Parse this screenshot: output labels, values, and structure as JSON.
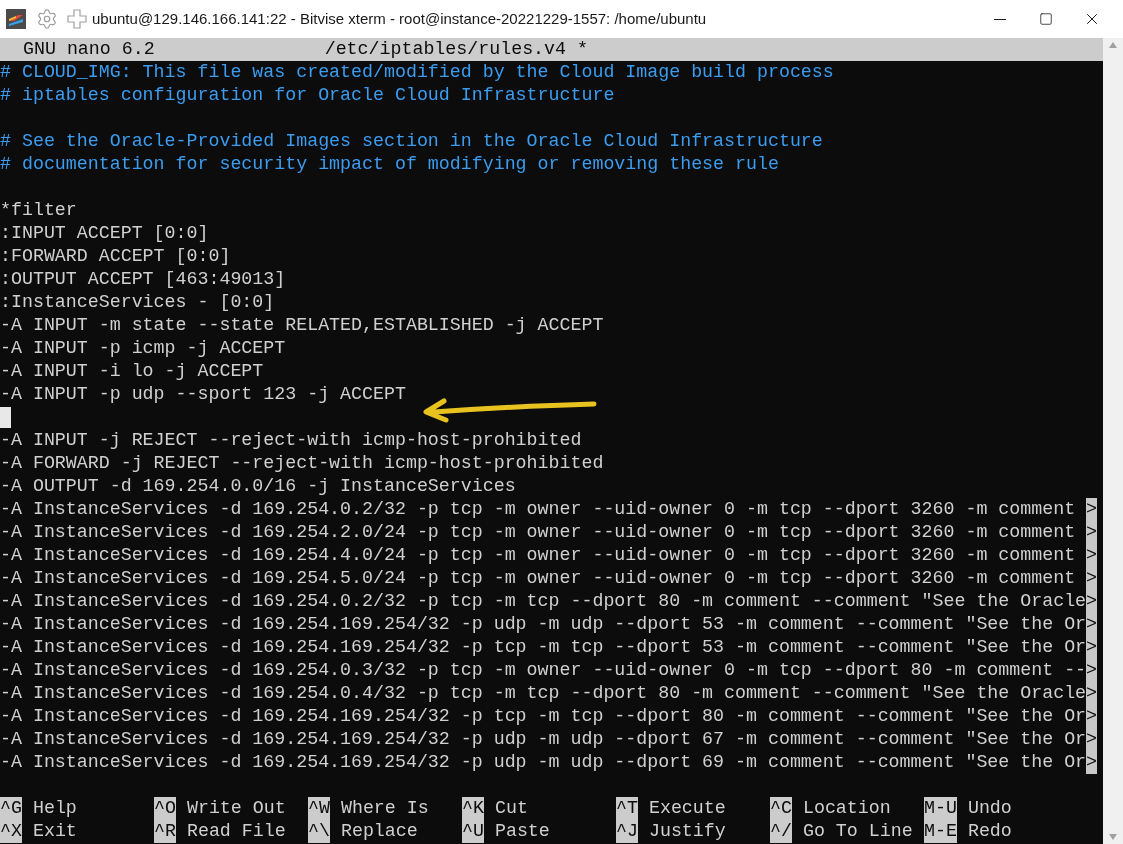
{
  "window": {
    "title": "ubuntu@129.146.166.141:22 - Bitvise xterm - root@instance-20221229-1557: /home/ubuntu"
  },
  "nano_header": {
    "version": "GNU nano 6.2",
    "filename": "/etc/iptables/rules.v4 *"
  },
  "lines": [
    {
      "kind": "comment",
      "text": "# CLOUD_IMG: This file was created/modified by the Cloud Image build process",
      "cursor": false
    },
    {
      "kind": "comment",
      "text": "# iptables configuration for Oracle Cloud Infrastructure",
      "cursor": false
    },
    {
      "kind": "blank",
      "cursor": false
    },
    {
      "kind": "comment",
      "text": "# See the Oracle-Provided Images section in the Oracle Cloud Infrastructure",
      "cursor": false
    },
    {
      "kind": "comment",
      "text": "# documentation for security impact of modifying or removing these rule",
      "cursor": false
    },
    {
      "kind": "blank",
      "cursor": false
    },
    {
      "kind": "code",
      "text": "*filter",
      "cursor": false
    },
    {
      "kind": "code",
      "text": ":INPUT ACCEPT [0:0]",
      "cursor": false
    },
    {
      "kind": "code",
      "text": ":FORWARD ACCEPT [0:0]",
      "cursor": false
    },
    {
      "kind": "code",
      "text": ":OUTPUT ACCEPT [463:49013]",
      "cursor": false
    },
    {
      "kind": "code",
      "text": ":InstanceServices - [0:0]",
      "cursor": false
    },
    {
      "kind": "code",
      "text": "-A INPUT -m state --state RELATED,ESTABLISHED -j ACCEPT",
      "cursor": false
    },
    {
      "kind": "code",
      "text": "-A INPUT -p icmp -j ACCEPT",
      "cursor": false
    },
    {
      "kind": "code",
      "text": "-A INPUT -i lo -j ACCEPT",
      "cursor": false
    },
    {
      "kind": "code",
      "text": "-A INPUT -p udp --sport 123 -j ACCEPT",
      "cursor": false
    },
    {
      "kind": "blank",
      "cursor": true
    },
    {
      "kind": "code",
      "text": "-A INPUT -j REJECT --reject-with icmp-host-prohibited",
      "cursor": false
    },
    {
      "kind": "code",
      "text": "-A FORWARD -j REJECT --reject-with icmp-host-prohibited",
      "cursor": false
    },
    {
      "kind": "code",
      "text": "-A OUTPUT -d 169.254.0.0/16 -j InstanceServices",
      "cursor": false
    },
    {
      "kind": "code",
      "text": "-A InstanceServices -d 169.254.0.2/32 -p tcp -m owner --uid-owner 0 -m tcp --dport 3260 -m comment ",
      "marker": ">",
      "cursor": false
    },
    {
      "kind": "code",
      "text": "-A InstanceServices -d 169.254.2.0/24 -p tcp -m owner --uid-owner 0 -m tcp --dport 3260 -m comment ",
      "marker": ">",
      "cursor": false
    },
    {
      "kind": "code",
      "text": "-A InstanceServices -d 169.254.4.0/24 -p tcp -m owner --uid-owner 0 -m tcp --dport 3260 -m comment ",
      "marker": ">",
      "cursor": false
    },
    {
      "kind": "code",
      "text": "-A InstanceServices -d 169.254.5.0/24 -p tcp -m owner --uid-owner 0 -m tcp --dport 3260 -m comment ",
      "marker": ">",
      "cursor": false
    },
    {
      "kind": "code",
      "text": "-A InstanceServices -d 169.254.0.2/32 -p tcp -m tcp --dport 80 -m comment --comment \"See the Oracle",
      "marker": ">",
      "cursor": false
    },
    {
      "kind": "code",
      "text": "-A InstanceServices -d 169.254.169.254/32 -p udp -m udp --dport 53 -m comment --comment \"See the Or",
      "marker": ">",
      "cursor": false
    },
    {
      "kind": "code",
      "text": "-A InstanceServices -d 169.254.169.254/32 -p tcp -m tcp --dport 53 -m comment --comment \"See the Or",
      "marker": ">",
      "cursor": false
    },
    {
      "kind": "code",
      "text": "-A InstanceServices -d 169.254.0.3/32 -p tcp -m owner --uid-owner 0 -m tcp --dport 80 -m comment --",
      "marker": ">",
      "cursor": false
    },
    {
      "kind": "code",
      "text": "-A InstanceServices -d 169.254.0.4/32 -p tcp -m tcp --dport 80 -m comment --comment \"See the Oracle",
      "marker": ">",
      "cursor": false
    },
    {
      "kind": "code",
      "text": "-A InstanceServices -d 169.254.169.254/32 -p tcp -m tcp --dport 80 -m comment --comment \"See the Or",
      "marker": ">",
      "cursor": false
    },
    {
      "kind": "code",
      "text": "-A InstanceServices -d 169.254.169.254/32 -p udp -m udp --dport 67 -m comment --comment \"See the Or",
      "marker": ">",
      "cursor": false
    },
    {
      "kind": "code",
      "text": "-A InstanceServices -d 169.254.169.254/32 -p udp -m udp --dport 69 -m comment --comment \"See the Or",
      "marker": ">",
      "cursor": false
    }
  ],
  "shortcuts": [
    [
      {
        "key": "^G",
        "label": "Help"
      },
      {
        "key": "^O",
        "label": "Write Out"
      },
      {
        "key": "^W",
        "label": "Where Is"
      },
      {
        "key": "^K",
        "label": "Cut"
      },
      {
        "key": "^T",
        "label": "Execute"
      },
      {
        "key": "^C",
        "label": "Location"
      },
      {
        "key": "M-U",
        "label": "Undo"
      }
    ],
    [
      {
        "key": "^X",
        "label": "Exit"
      },
      {
        "key": "^R",
        "label": "Read File"
      },
      {
        "key": "^\\",
        "label": "Replace"
      },
      {
        "key": "^U",
        "label": "Paste"
      },
      {
        "key": "^J",
        "label": "Justify"
      },
      {
        "key": "^/",
        "label": "Go To Line"
      },
      {
        "key": "M-E",
        "label": "Redo"
      }
    ]
  ]
}
